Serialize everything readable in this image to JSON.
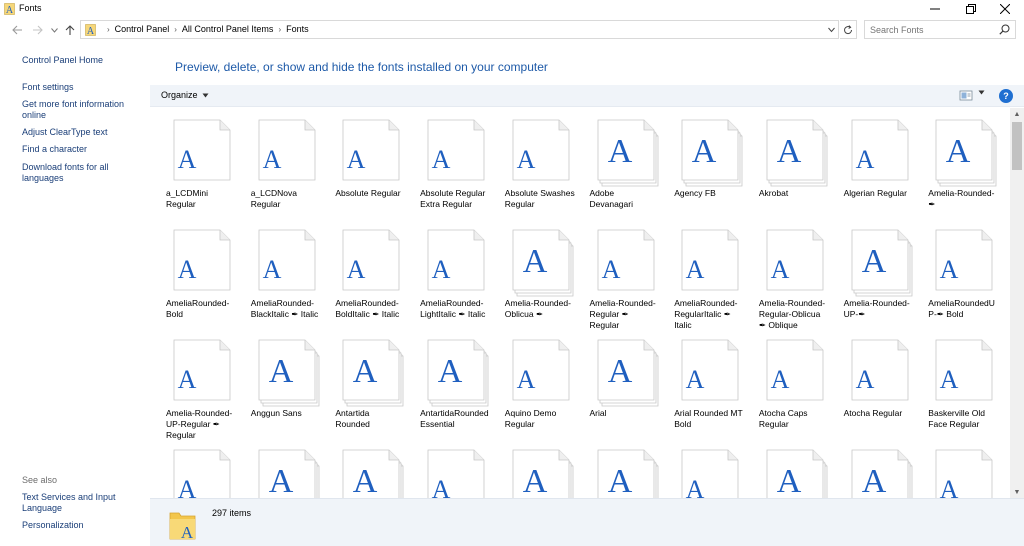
{
  "window": {
    "title": "Fonts"
  },
  "address": {
    "crumbs": [
      "Control Panel",
      "All Control Panel Items",
      "Fonts"
    ],
    "search_placeholder": "Search Fonts"
  },
  "sidebar": {
    "links": [
      {
        "label": "Control Panel Home"
      },
      {
        "label": "Font settings"
      },
      {
        "label": "Get more font information online"
      },
      {
        "label": "Adjust ClearType text"
      },
      {
        "label": "Find a character"
      },
      {
        "label": "Download fonts for all languages"
      }
    ],
    "see_also_label": "See also",
    "see_also": [
      {
        "label": "Text Services and Input Language"
      },
      {
        "label": "Personalization"
      }
    ]
  },
  "main": {
    "heading": "Preview, delete, or show and hide the fonts installed on your computer",
    "organize_label": "Organize",
    "help_label": "?",
    "status_count": "297 items"
  },
  "colors": {
    "accent": "#1e5aa8",
    "glyph": "#1f5fbf",
    "link": "#1a3e78"
  },
  "fonts": [
    {
      "name": "a_LCDMini Regular",
      "family": false
    },
    {
      "name": "a_LCDNova Regular",
      "family": false
    },
    {
      "name": "Absolute Regular",
      "family": false
    },
    {
      "name": "Absolute Regular Extra Regular",
      "family": false
    },
    {
      "name": "Absolute Swashes Regular",
      "family": false
    },
    {
      "name": "Adobe Devanagari",
      "family": true
    },
    {
      "name": "Agency FB",
      "family": true
    },
    {
      "name": "Akrobat",
      "family": true
    },
    {
      "name": "Algerian Regular",
      "family": false
    },
    {
      "name": "Amelia-Rounded-✒",
      "family": true
    },
    {
      "name": "AmeliaRounded-Bold",
      "family": false
    },
    {
      "name": "AmeliaRounded-BlackItalic ✒ Italic",
      "family": false
    },
    {
      "name": "AmeliaRounded-BoldItalic ✒ Italic",
      "family": false
    },
    {
      "name": "AmeliaRounded-LightItalic ✒ Italic",
      "family": false
    },
    {
      "name": "Amelia-Rounded-Oblicua ✒",
      "family": true
    },
    {
      "name": "Amelia-Rounded-Regular ✒ Regular",
      "family": false
    },
    {
      "name": "AmeliaRounded-RegularItalic ✒ Italic",
      "family": false
    },
    {
      "name": "Amelia-Rounded-Regular-Oblicua ✒ Oblique",
      "family": false
    },
    {
      "name": "Amelia-Rounded-UP-✒",
      "family": true
    },
    {
      "name": "AmeliaRoundedUP-✒ Bold",
      "family": false
    },
    {
      "name": "Amelia-Rounded-UP-Regular ✒ Regular",
      "family": false
    },
    {
      "name": "Anggun Sans",
      "family": true
    },
    {
      "name": "Antartida Rounded",
      "family": true
    },
    {
      "name": "AntartidaRounded Essential",
      "family": true
    },
    {
      "name": "Aquino Demo Regular",
      "family": false
    },
    {
      "name": "Arial",
      "family": true
    },
    {
      "name": "Arial Rounded MT Bold",
      "family": false
    },
    {
      "name": "Atocha Caps Regular",
      "family": false
    },
    {
      "name": "Atocha Regular",
      "family": false
    },
    {
      "name": "Baskerville Old Face Regular",
      "family": false
    },
    {
      "name": "",
      "family": false
    },
    {
      "name": "",
      "family": true
    },
    {
      "name": "",
      "family": true
    },
    {
      "name": "",
      "family": false
    },
    {
      "name": "",
      "family": true
    },
    {
      "name": "",
      "family": true
    },
    {
      "name": "",
      "family": false
    },
    {
      "name": "",
      "family": true
    },
    {
      "name": "",
      "family": true
    },
    {
      "name": "",
      "family": false
    }
  ]
}
